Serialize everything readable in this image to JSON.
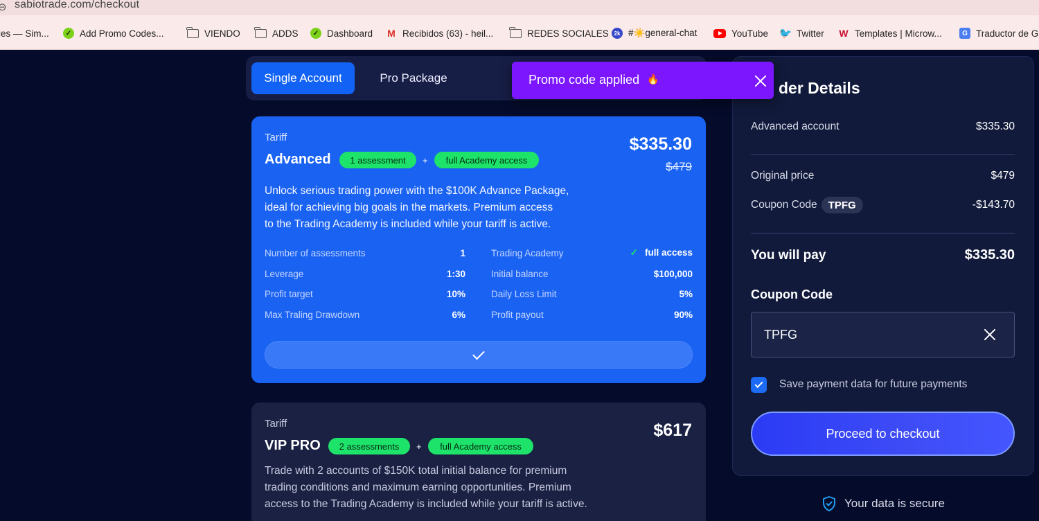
{
  "browser": {
    "url": "sabiotrade.com/checkout",
    "bookmarks": [
      {
        "label": "les — Sim...",
        "icon": "none"
      },
      {
        "label": "Add Promo Codes...",
        "icon": "green-badge-icon"
      },
      {
        "label": "VIENDO",
        "icon": "folder-icon"
      },
      {
        "label": "ADDS",
        "icon": "folder-icon"
      },
      {
        "label": "Dashboard",
        "icon": "green-badge-icon"
      },
      {
        "label": "Recibidos (63) - heil...",
        "icon": "gmail-icon"
      },
      {
        "label": "REDES SOCIALES",
        "icon": "folder-icon"
      },
      {
        "label": "#☀️general-chat",
        "icon": "discord-badge-icon"
      },
      {
        "label": "YouTube",
        "icon": "youtube-icon"
      },
      {
        "label": "Twitter",
        "icon": "twitter-icon"
      },
      {
        "label": "Templates | Microw...",
        "icon": "microsoft-icon"
      },
      {
        "label": "Traductor de G",
        "icon": "translate-icon"
      }
    ]
  },
  "tabs": {
    "single": "Single Account",
    "pro": "Pro Package",
    "active": "single"
  },
  "toast": {
    "message": "Promo code applied",
    "emoji": "🔥"
  },
  "plans": {
    "advanced": {
      "label": "Tariff",
      "name": "Advanced",
      "pill1": "1 assessment",
      "plus": "+",
      "pill2": "full Academy access",
      "price": "$335.30",
      "old_price": "$479",
      "description": [
        "Unlock serious trading power with the $100K Advance Package,",
        "ideal for achieving big goals in the markets. Premium access",
        "to the Trading Academy is included while your tariff is active."
      ],
      "specs_left": [
        {
          "key": "Number of assessments",
          "value": "1"
        },
        {
          "key": "Leverage",
          "value": "1:30"
        },
        {
          "key": "Profit target",
          "value": "10%"
        },
        {
          "key": "Max Traling Drawdown",
          "value": "6%"
        }
      ],
      "specs_right": [
        {
          "key": "Trading Academy",
          "value": "full access"
        },
        {
          "key": "Initial balance",
          "value": "$100,000"
        },
        {
          "key": "Daily Loss Limit",
          "value": "5%"
        },
        {
          "key": "Profit payout",
          "value": "90%"
        }
      ],
      "accent": "#1a63f2"
    },
    "vip": {
      "label": "Tariff",
      "name": "VIP PRO",
      "pill1": "2 assessments",
      "plus": "+",
      "pill2": "full Academy access",
      "price": "$617",
      "description": [
        "Trade with 2 accounts of $150K total initial balance for premium",
        "trading conditions and maximum earning opportunities. Premium",
        "access to the Trading Academy is included while your tariff is active."
      ]
    }
  },
  "order": {
    "title": "der Details",
    "account_label": "Advanced account",
    "account_value": "$335.30",
    "original_label": "Original price",
    "original_value": "$479",
    "coupon_label": "Coupon Code",
    "coupon_chip": "TPFG",
    "coupon_value": "-$143.70",
    "total_label": "You will pay",
    "total_value": "$335.30",
    "coupon_field_label": "Coupon Code",
    "coupon_field_value": "TPFG",
    "save_label": "Save payment data for future payments",
    "save_checked": true,
    "proceed_label": "Proceed to checkout",
    "secure_label": "Your data is secure"
  },
  "colors": {
    "background": "#050b2a",
    "primary": "#1263f5",
    "toast": "#7b16ff",
    "pill": "#1ee36a"
  }
}
